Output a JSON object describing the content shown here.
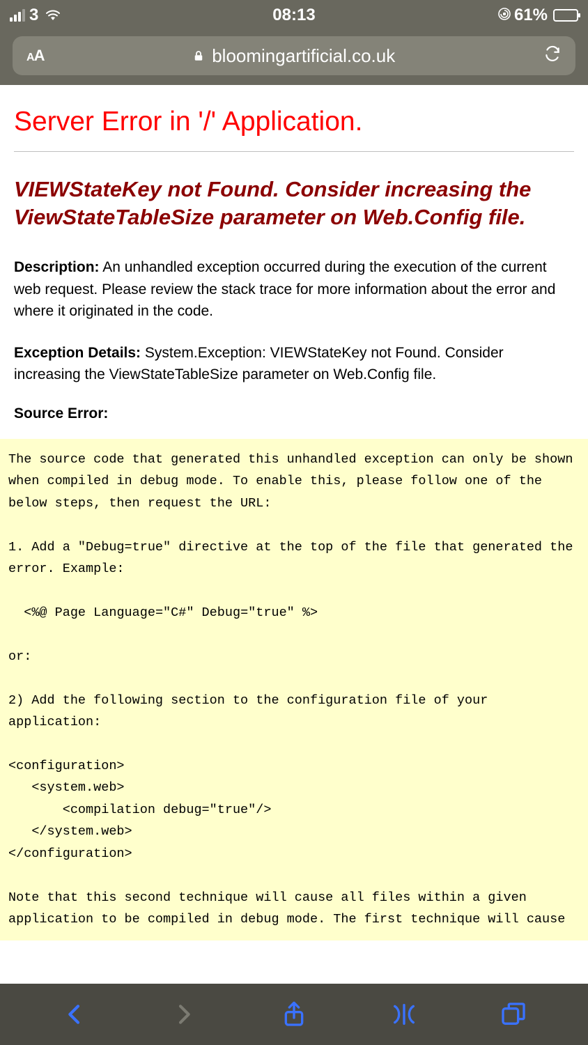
{
  "status": {
    "carrier": "3",
    "time": "08:13",
    "battery_pct": "61%"
  },
  "urlbar": {
    "aa": "AA",
    "domain": "bloomingartificial.co.uk"
  },
  "error": {
    "title": "Server Error in '/' Application.",
    "subtitle": "VIEWStateKey not Found. Consider increasing the ViewStateTableSize parameter on Web.Config file.",
    "description_label": "Description:",
    "description_text": " An unhandled exception occurred during the execution of the current web request. Please review the stack trace for more information about the error and where it originated in the code.",
    "exception_label": "Exception Details:",
    "exception_text": " System.Exception: VIEWStateKey not Found. Consider increasing the ViewStateTableSize parameter on Web.Config file.",
    "source_label": "Source Error:",
    "code": "The source code that generated this unhandled exception can only be shown when compiled in debug mode. To enable this, please follow one of the below steps, then request the URL:\n\n1. Add a \"Debug=true\" directive at the top of the file that generated the error. Example:\n\n  <%@ Page Language=\"C#\" Debug=\"true\" %>\n\nor:\n\n2) Add the following section to the configuration file of your application:\n\n<configuration>\n   <system.web>\n       <compilation debug=\"true\"/>\n   </system.web>\n</configuration>\n\nNote that this second technique will cause all files within a given application to be compiled in debug mode. The first technique will cause"
  }
}
